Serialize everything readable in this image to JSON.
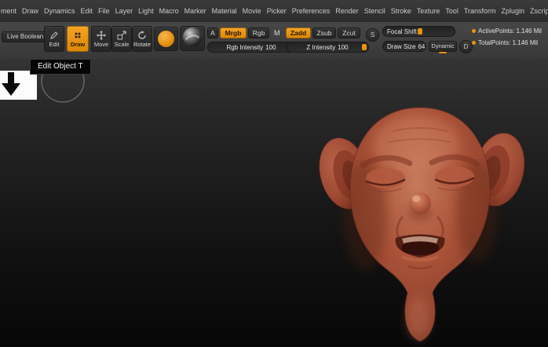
{
  "menu": {
    "items": [
      "ment",
      "Draw",
      "Dynamics",
      "Edit",
      "File",
      "Layer",
      "Light",
      "Macro",
      "Marker",
      "Material",
      "Movie",
      "Picker",
      "Preferences",
      "Render",
      "Stencil",
      "Stroke",
      "Texture",
      "Tool",
      "Transform",
      "Zplugin",
      "Zscript"
    ]
  },
  "toolbar": {
    "live_boolean": "Live Boolean",
    "edit": "Edit",
    "draw": "Draw",
    "move": "Move",
    "scale": "Scale",
    "rotate": "Rotate",
    "a": "A",
    "mrgb": "Mrgb",
    "rgb": "Rgb",
    "m": "M",
    "zadd": "Zadd",
    "zsub": "Zsub",
    "zcut": "Zcut",
    "dynamic": "Dynamic",
    "s_badge": "S",
    "d_badge": "D",
    "sliders": {
      "rgb_intensity": {
        "label": "Rgb Intensity",
        "value": "100"
      },
      "z_intensity": {
        "label": "Z Intensity",
        "value": "100"
      },
      "focal_shift": {
        "label": "Focal Shift",
        "value": "0"
      },
      "draw_size": {
        "label": "Draw Size",
        "value": "64"
      }
    }
  },
  "stats": {
    "active_points": "ActivePoints: 1.146 Mil",
    "total_points": "TotalPoints: 1.146 Mil"
  },
  "tooltip": {
    "text": "Edit Object T"
  },
  "colors": {
    "accent": "#e8940e",
    "skin": "#a85138",
    "canvas_top": "#343434",
    "canvas_bottom": "#070707"
  }
}
